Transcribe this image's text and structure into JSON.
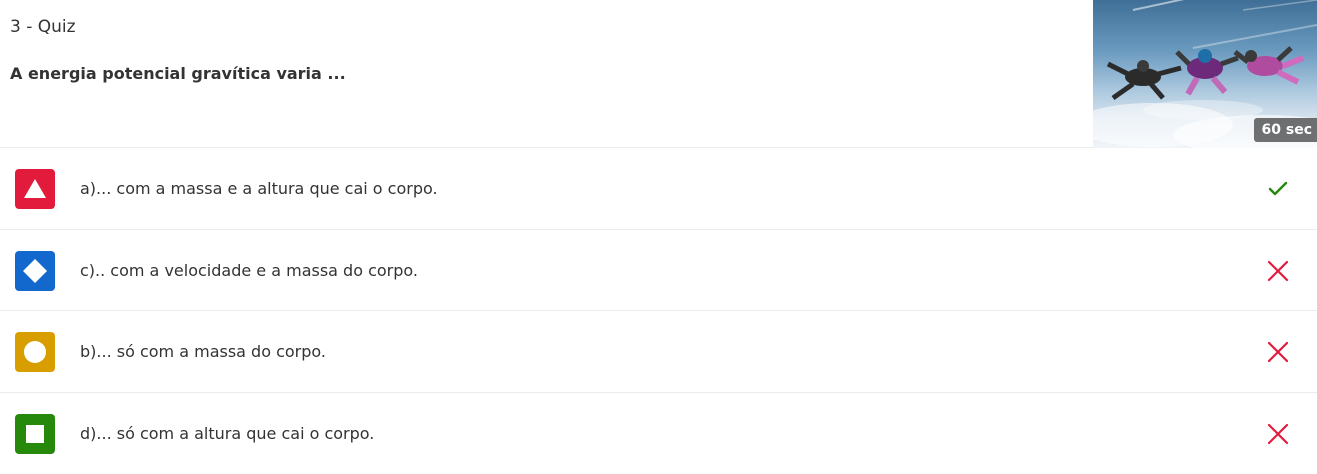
{
  "quiz": {
    "label": "3 - Quiz",
    "question": "A energia potencial gravítica varia ...",
    "timer": "60 sec"
  },
  "options": [
    {
      "text": "a)... com a massa e a altura que cai o corpo.",
      "shape": "triangle-icon",
      "color": "#e21b3c",
      "correct": true
    },
    {
      "text": "c).. com a velocidade e a massa do corpo.",
      "shape": "diamond-icon",
      "color": "#1368ce",
      "correct": false
    },
    {
      "text": "b)... só com a massa do corpo.",
      "shape": "circle-icon",
      "color": "#d89e00",
      "correct": false
    },
    {
      "text": "d)... só com a altura que cai o corpo.",
      "shape": "square-icon",
      "color": "#26890c",
      "correct": false
    }
  ],
  "status_colors": {
    "correct": "#26890c",
    "incorrect": "#e21b3c"
  }
}
